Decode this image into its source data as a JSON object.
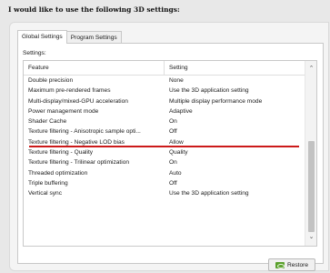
{
  "heading": "I would like to use the following 3D settings:",
  "tabs": [
    {
      "label": "Global Settings",
      "active": true
    },
    {
      "label": "Program Settings",
      "active": false
    }
  ],
  "settings_label": "Settings:",
  "columns": {
    "feature": "Feature",
    "setting": "Setting"
  },
  "rows": [
    {
      "feature": "Double precision",
      "setting": "None"
    },
    {
      "feature": "Maximum pre-rendered frames",
      "setting": "Use the 3D application setting"
    },
    {
      "feature": "Multi-display/mixed-GPU acceleration",
      "setting": "Multiple display performance mode"
    },
    {
      "feature": "Power management mode",
      "setting": "Adaptive"
    },
    {
      "feature": "Shader Cache",
      "setting": "On"
    },
    {
      "feature": "Texture filtering - Anisotropic sample opti...",
      "setting": "Off"
    },
    {
      "feature": "Texture filtering - Negative LOD bias",
      "setting": "Allow"
    },
    {
      "feature": "Texture filtering - Quality",
      "setting": "Quality"
    },
    {
      "feature": "Texture filtering - Trilinear optimization",
      "setting": "On"
    },
    {
      "feature": "Threaded optimization",
      "setting": "Auto"
    },
    {
      "feature": "Triple buffering",
      "setting": "Off"
    },
    {
      "feature": "Vertical sync",
      "setting": "Use the 3D application setting"
    }
  ],
  "restore_label": "Restore",
  "colors": {
    "highlight_underline": "#cc1a1a",
    "nvidia_green": "#5aa02c"
  },
  "icons": {
    "scroll_up": "chevron-up-icon",
    "scroll_down": "chevron-down-icon",
    "restore": "nvidia-icon"
  }
}
